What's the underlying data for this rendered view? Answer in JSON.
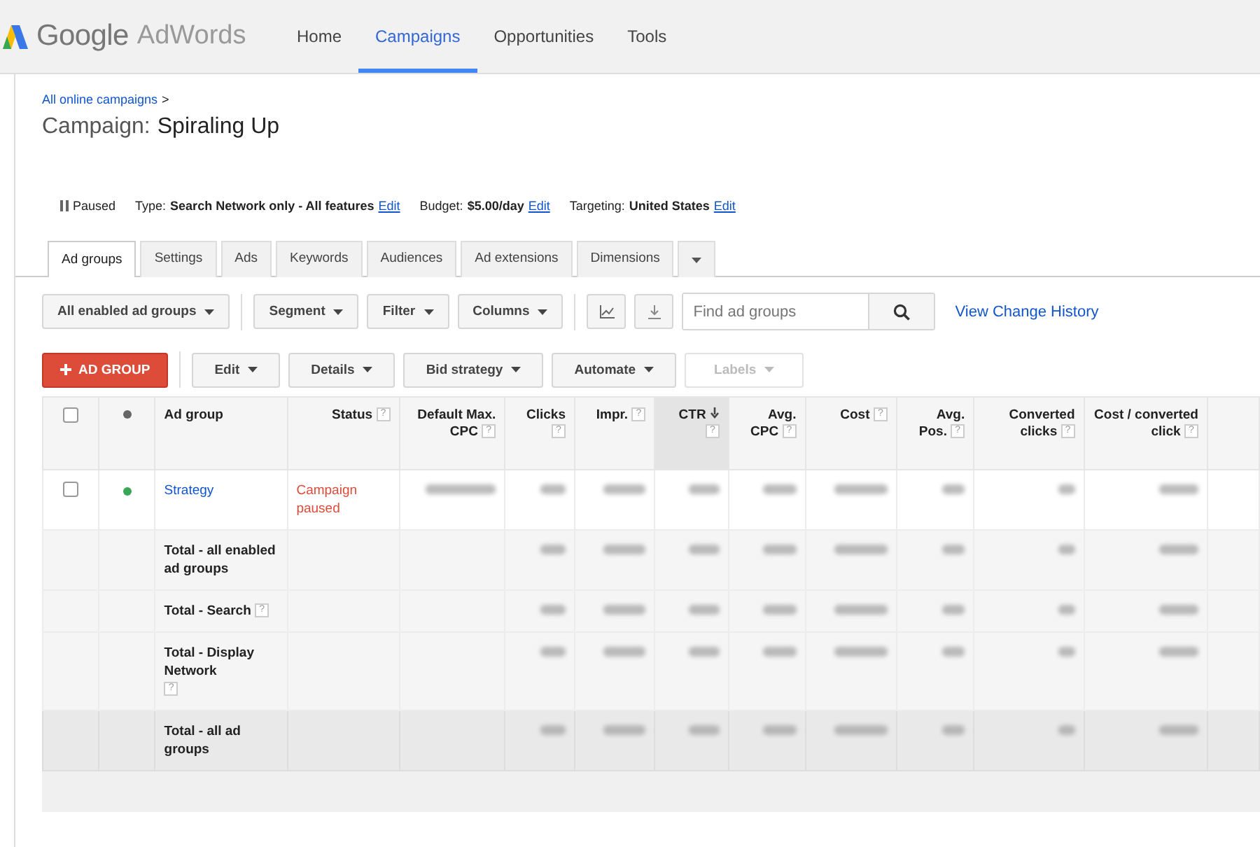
{
  "header": {
    "logo_primary": "Google",
    "logo_secondary": "AdWords",
    "nav": [
      {
        "label": "Home",
        "selected": false
      },
      {
        "label": "Campaigns",
        "selected": true
      },
      {
        "label": "Opportunities",
        "selected": false
      },
      {
        "label": "Tools",
        "selected": false
      }
    ]
  },
  "breadcrumb": {
    "link": "All online campaigns",
    "separator": ">"
  },
  "title": {
    "prefix": "Campaign:",
    "name": "Spiraling Up"
  },
  "settings": [
    {
      "kind": "status",
      "value": "Paused"
    },
    {
      "kind": "setting",
      "label": "Type:",
      "value": "Search Network only - All features",
      "link": "Edit"
    },
    {
      "kind": "setting",
      "label": "Budget:",
      "value": "$5.00/day",
      "link": "Edit"
    },
    {
      "kind": "setting",
      "label": "Targeting:",
      "value": "United States",
      "link": "Edit"
    }
  ],
  "tabs": [
    {
      "label": "Ad groups",
      "selected": true
    },
    {
      "label": "Settings",
      "selected": false
    },
    {
      "label": "Ads",
      "selected": false
    },
    {
      "label": "Keywords",
      "selected": false
    },
    {
      "label": "Audiences",
      "selected": false
    },
    {
      "label": "Ad extensions",
      "selected": false
    },
    {
      "label": "Dimensions",
      "selected": false
    }
  ],
  "toolbar": {
    "buttons": [
      {
        "label": "All enabled ad groups"
      },
      {
        "label": "Segment"
      },
      {
        "label": "Filter"
      },
      {
        "label": "Columns"
      }
    ],
    "search": {
      "placeholder": "Find ad groups"
    },
    "link": "View Change History"
  },
  "actions": {
    "primary": "AD GROUP",
    "buttons": [
      {
        "label": "Edit",
        "disabled": false
      },
      {
        "label": "Details",
        "disabled": false
      },
      {
        "label": "Bid strategy",
        "disabled": false
      },
      {
        "label": "Automate",
        "disabled": false
      },
      {
        "label": "Labels",
        "disabled": true
      }
    ]
  },
  "table": {
    "select_all_checked": false,
    "columns": [
      {
        "label": "Ad group",
        "sorted": false
      },
      {
        "label": "Status",
        "help": "?",
        "sorted": false
      },
      {
        "label": "Default Max. CPC",
        "help": "?",
        "sorted": false
      },
      {
        "label": "Clicks",
        "help": "?",
        "sorted": false
      },
      {
        "label": "Impr.",
        "help": "?",
        "sorted": false
      },
      {
        "label": "CTR",
        "help": "?",
        "sorted": true
      },
      {
        "label": "Avg. CPC",
        "help": "?",
        "sorted": false
      },
      {
        "label": "Cost",
        "help": "?",
        "sorted": false
      },
      {
        "label": "Avg. Pos.",
        "help": "?",
        "sorted": false
      },
      {
        "label": "Converted clicks",
        "help": "?",
        "sorted": false
      },
      {
        "label": "Cost / converted click",
        "help": "?",
        "sorted": false
      }
    ],
    "rows": [
      {
        "kind": "ad_group",
        "name": "Strategy",
        "status": "Campaign paused",
        "checked": false
      },
      {
        "kind": "total",
        "name": "Total - all enabled ad groups"
      },
      {
        "kind": "total",
        "name": "Total - Search",
        "help": "?"
      },
      {
        "kind": "total",
        "name": "Total - Display Network",
        "help": "?"
      },
      {
        "kind": "grand_total",
        "name": "Total - all ad groups"
      }
    ]
  }
}
